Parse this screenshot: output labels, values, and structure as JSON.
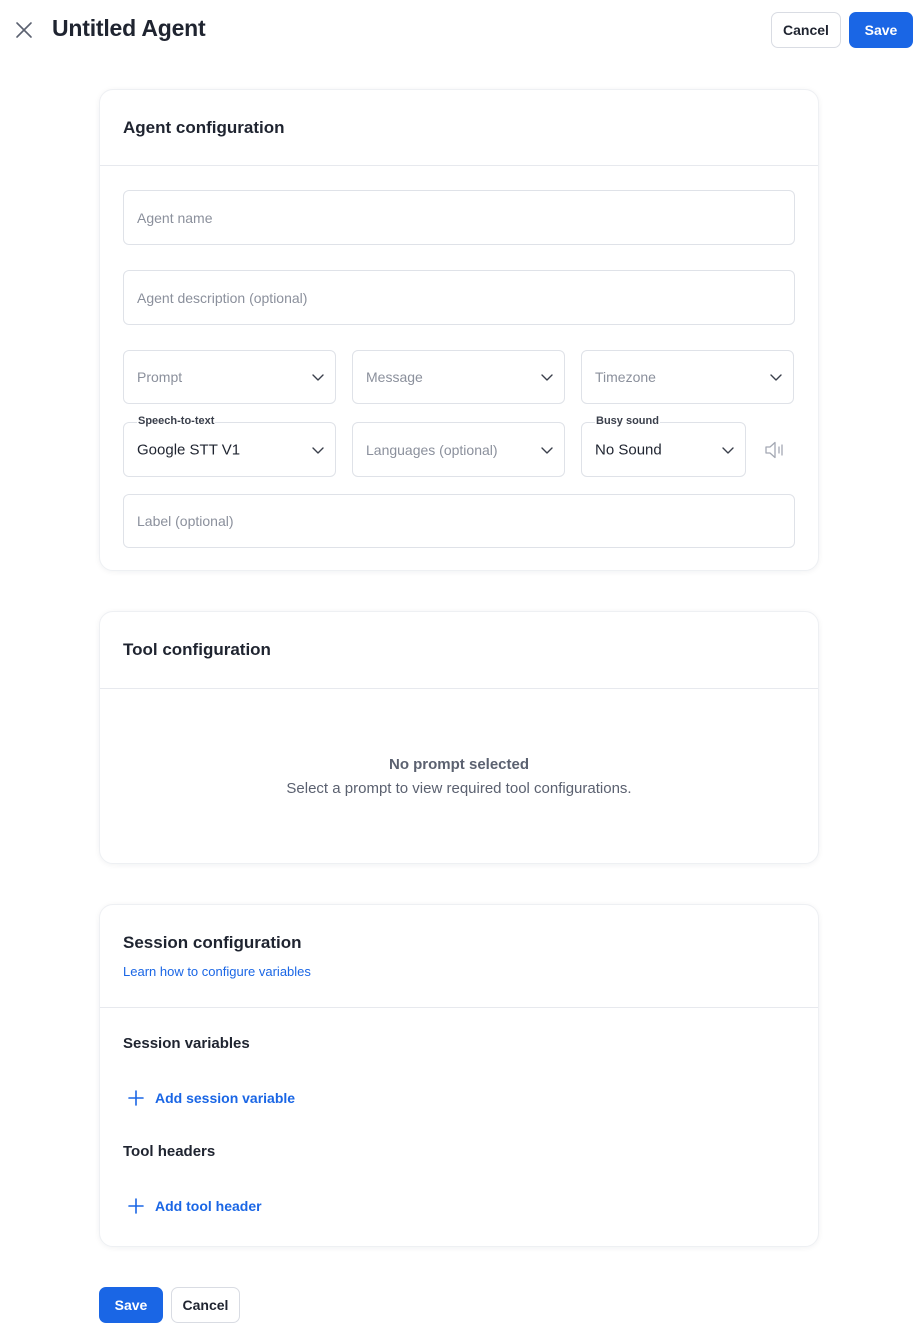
{
  "header": {
    "title": "Untitled Agent",
    "cancel_label": "Cancel",
    "save_label": "Save"
  },
  "agent_config": {
    "title": "Agent configuration",
    "agent_name_placeholder": "Agent name",
    "agent_description_placeholder": "Agent description (optional)",
    "prompt_placeholder": "Prompt",
    "message_placeholder": "Message",
    "timezone_placeholder": "Timezone",
    "stt_label": "Speech-to-text",
    "stt_value": "Google STT V1",
    "languages_placeholder": "Languages (optional)",
    "busy_sound_label": "Busy sound",
    "busy_sound_value": "No Sound",
    "label_placeholder": "Label (optional)"
  },
  "tool_config": {
    "title": "Tool configuration",
    "empty_title": "No prompt selected",
    "empty_subtitle": "Select a prompt to view required tool configurations."
  },
  "session_config": {
    "title": "Session configuration",
    "learn_link": "Learn how to configure variables",
    "session_variables_title": "Session variables",
    "add_session_variable": "Add session variable",
    "tool_headers_title": "Tool headers",
    "add_tool_header": "Add tool header"
  },
  "footer": {
    "save_label": "Save",
    "cancel_label": "Cancel"
  },
  "colors": {
    "primary": "#1a66e5",
    "text": "#1f2430",
    "muted": "#8b909c",
    "border": "#dfe2e8"
  }
}
